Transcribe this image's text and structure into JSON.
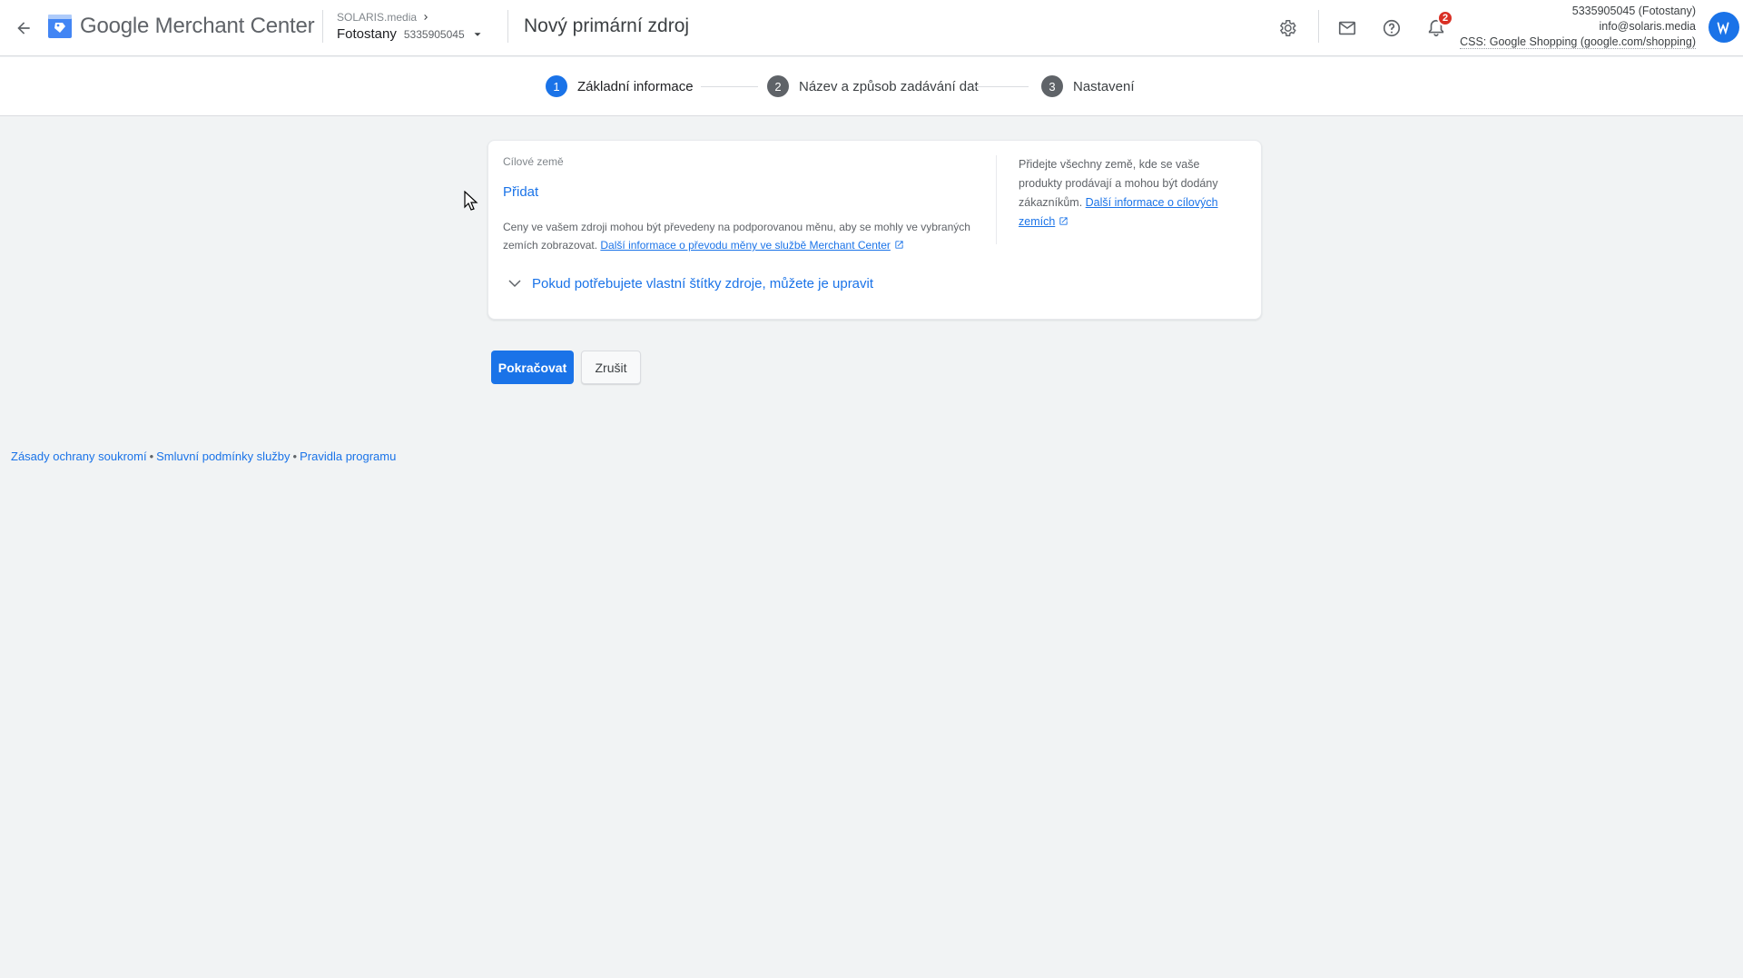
{
  "header": {
    "product_name": "Google Merchant Center",
    "account_parent": "SOLARIS.media",
    "account_name": "Fotostany",
    "account_id": "5335905045",
    "page_title": "Nový primární zdroj",
    "notification_count": "2",
    "account_info": {
      "line1": "5335905045 (Fotostany)",
      "line2": "info@solaris.media",
      "line3": "CSS: Google Shopping (google.com/shopping)"
    },
    "icons": [
      "arrow-back-icon",
      "merchant-center-logo",
      "chevron-right-icon",
      "dropdown-arrow-icon",
      "settings-gear-icon",
      "mail-icon",
      "help-icon",
      "notifications-bell-icon",
      "avatar"
    ]
  },
  "stepper": {
    "steps": [
      {
        "num": "1",
        "label": "Základní informace",
        "active": true
      },
      {
        "num": "2",
        "label": "Název a způsob zadávání dat",
        "active": false
      },
      {
        "num": "3",
        "label": "Nastavení",
        "active": false
      }
    ]
  },
  "card": {
    "field_label": "Cílové země",
    "add_label": "Přidat",
    "currency_note": "Ceny ve vašem zdroji mohou být převedeny na podporovanou měnu, aby se mohly ve vybraných zemích zobrazovat.",
    "currency_link": "Další informace o převodu měny ve službě Merchant Center",
    "help_text": "Přidejte všechny země, kde se vaše produkty prodávají a mohou být dodány zákazníkům.",
    "help_link": "Další informace o cílových zemích",
    "expand_label": "Pokud potřebujete vlastní štítky zdroje, můžete je upravit"
  },
  "actions": {
    "continue_label": "Pokračovat",
    "cancel_label": "Zrušit"
  },
  "footer": {
    "links": [
      "Zásady ochrany soukromí",
      "Smluvní podmínky služby",
      "Pravidla programu"
    ],
    "separator": "•"
  },
  "colors": {
    "primary": "#1a73e8",
    "step_inactive": "#5f6368",
    "notification_badge": "#d93025",
    "background": "#f1f3f4"
  }
}
